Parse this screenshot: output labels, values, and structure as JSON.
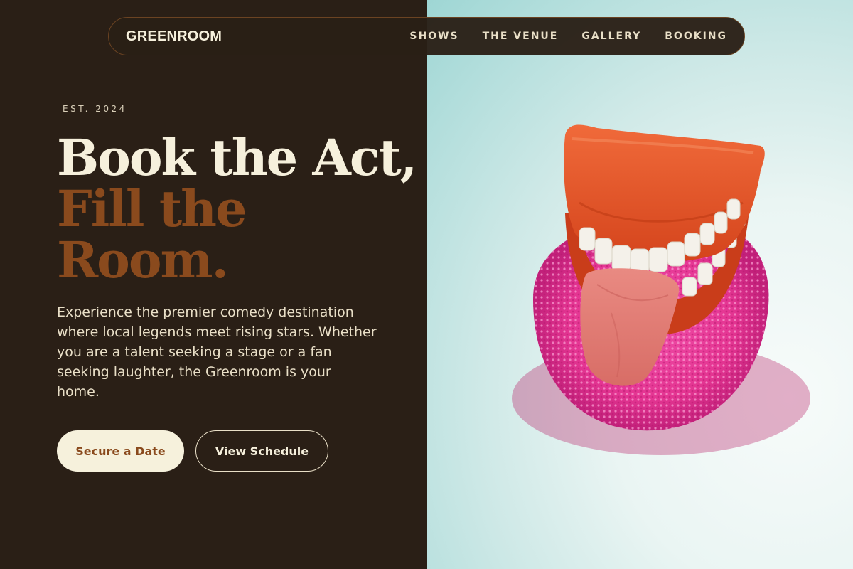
{
  "nav": {
    "brand": "GREENROOM",
    "links": [
      "SHOWS",
      "THE VENUE",
      "GALLERY",
      "BOOKING"
    ]
  },
  "hero": {
    "eyebrow": "EST. 2024",
    "headline_line1": "Book the Act,",
    "headline_line2": "Fill the",
    "headline_line3": "Room.",
    "description": "Experience the premier comedy destination where local legends meet rising stars. Whether you are a talent seeking a stage or a fan seeking laughter, the Greenroom is your home.",
    "primary_cta": "Secure a Date",
    "secondary_cta": "View Schedule"
  },
  "colors": {
    "background": "#2a1f16",
    "cream": "#f6f0dc",
    "accent_brown": "#8a4a1d",
    "image_bg": "#cfe9e7"
  },
  "image": {
    "subject": "wind-up chattering teeth toy with tongue on pink sponge"
  }
}
